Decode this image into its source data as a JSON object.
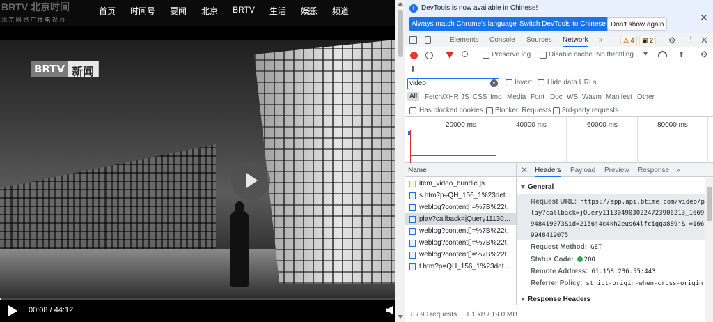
{
  "page": {
    "logo": "BRTV 北京时间",
    "logo_sub": "北京网络广播电视台",
    "nav": [
      "首页",
      "时间号",
      "要闻",
      "北京",
      "BRTV",
      "生活",
      "娱乐",
      "频道"
    ],
    "video_badge_brand": "BRTV",
    "video_badge_text": "新闻",
    "time": "00:08 / 44:12",
    "progress": 0.003
  },
  "devtools": {
    "info_message": "DevTools is now available in Chinese!",
    "btn_match": "Always match Chrome's language",
    "btn_switch": "Switch DevTools to Chinese",
    "btn_dont": "Don't show again",
    "tabs": [
      "Elements",
      "Console",
      "Sources",
      "Network"
    ],
    "more_tabs": "»",
    "warnings": "4",
    "issues": "2",
    "toolbar": {
      "preserve_log": "Preserve log",
      "disable_cache": "Disable cache",
      "throttling": "No throttling"
    },
    "filter": {
      "value": "video",
      "invert": "Invert",
      "hide_data_urls": "Hide data URLs",
      "types": [
        "All",
        "Fetch/XHR",
        "JS",
        "CSS",
        "Img",
        "Media",
        "Font",
        "Doc",
        "WS",
        "Wasm",
        "Manifest",
        "Other"
      ],
      "has_blocked_cookies": "Has blocked cookies",
      "blocked_requests": "Blocked Requests",
      "third_party": "3rd-party requests"
    },
    "overview_ticks": [
      "20000 ms",
      "40000 ms",
      "60000 ms",
      "80000 ms"
    ],
    "name_header": "Name",
    "detail_tabs": [
      "Headers",
      "Payload",
      "Preview",
      "Response"
    ],
    "requests": [
      {
        "name": "item_video_bundle.js",
        "type": "js"
      },
      {
        "name": "s.htm?p=QH_156_1%23detail...",
        "type": "doc"
      },
      {
        "name": "weblog?content[]=%7B%22ts...",
        "type": "doc"
      },
      {
        "name": "play?callback=jQuery1113049...",
        "type": "doc"
      },
      {
        "name": "weblog?content[]=%7B%22ts...",
        "type": "doc"
      },
      {
        "name": "weblog?content[]=%7B%22ts...",
        "type": "doc"
      },
      {
        "name": "weblog?content[]=%7B%22ts...",
        "type": "doc"
      },
      {
        "name": "t.htm?p=QH_156_1%23detail_...",
        "type": "doc"
      }
    ],
    "selected_request": 3,
    "status": {
      "requests": "8 / 90 requests",
      "transferred": "1.1 kB / 19.0 MB"
    },
    "general": {
      "title": "General",
      "request_url_label": "Request URL:",
      "request_url": "https://app.api.btime.com/video/play?callback=jQuery1113049030224723906213_1669948419073&id=2156j4c4kh2eus64lfcigqa889j&_=1669948419075",
      "method_label": "Request Method:",
      "method": "GET",
      "status_label": "Status Code:",
      "status": "200",
      "remote_label": "Remote Address:",
      "remote": "61.158.236.55:443",
      "referrer_label": "Referrer Policy:",
      "referrer": "strict-origin-when-cross-origin"
    },
    "response_headers_title": "Response Headers"
  },
  "colors": {
    "accent": "#1a73e8",
    "record": "#e53935",
    "status_ok": "#34a853"
  }
}
